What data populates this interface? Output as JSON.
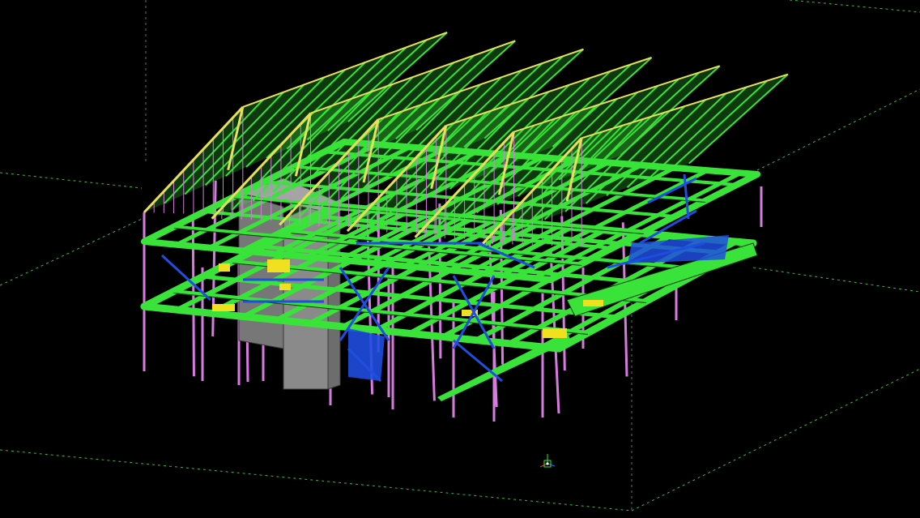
{
  "viewport": {
    "name": "3D model view",
    "background": "#000000"
  },
  "colors": {
    "grid_lines": "#3fb83f",
    "grid_vertical": "#6a6a6a",
    "beams": "#39e339",
    "beam_edges": "#0f3a0f",
    "columns": "#d77be0",
    "bracing": "#1f4ee0",
    "rafters": "#e8e05a",
    "core_wall": "#8a8a8a",
    "plates": "#f0e020"
  },
  "icons": {
    "view_gizmo": "axis-triad-icon"
  },
  "model": {
    "roof_ridges": 6,
    "floor_levels": 3
  }
}
